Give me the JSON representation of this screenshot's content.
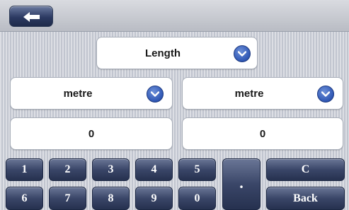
{
  "header": {
    "back_icon": "back-arrow-icon"
  },
  "category": {
    "selected": "Length"
  },
  "from_unit": {
    "selected": "metre",
    "value": "0"
  },
  "to_unit": {
    "selected": "metre",
    "value": "0"
  },
  "keypad": {
    "row1": [
      "1",
      "2",
      "3",
      "4",
      "5"
    ],
    "row2": [
      "6",
      "7",
      "8",
      "9",
      "0"
    ],
    "dot": ".",
    "clear": "C",
    "back": "Back"
  },
  "colors": {
    "key_dark": "#2c3a62",
    "accent_blue": "#2f57b4",
    "field_bg": "#ffffff"
  }
}
